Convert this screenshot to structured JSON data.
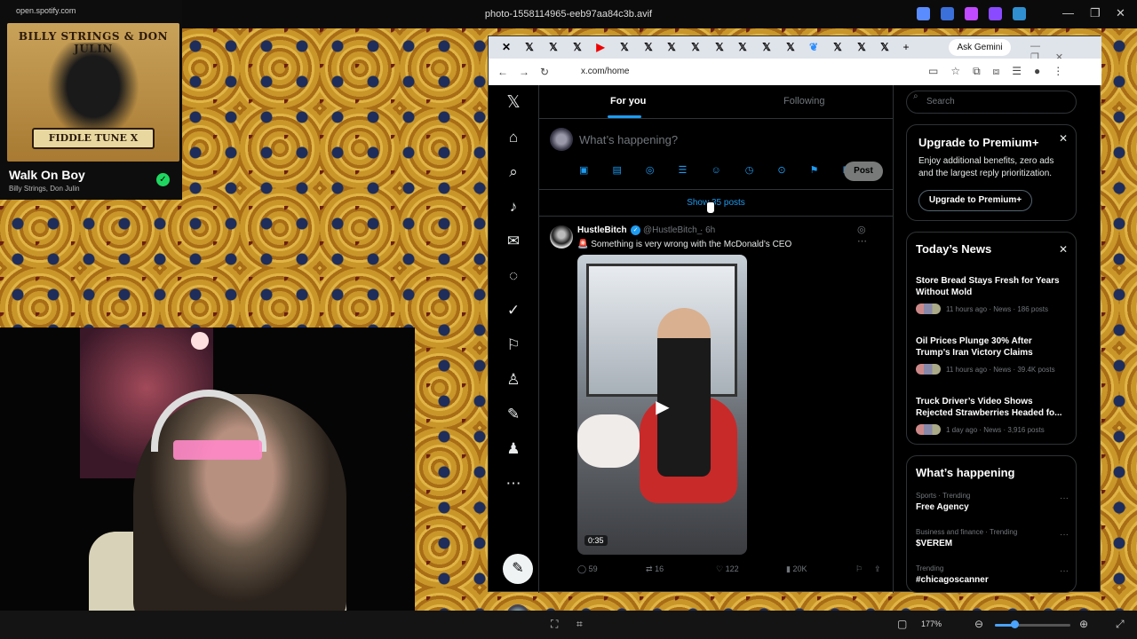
{
  "window": {
    "title": "photo-1558114965-eeb97aa84c3b.avif",
    "controls": [
      "—",
      "❐",
      "✕"
    ]
  },
  "spotify": {
    "url": "open.spotify.com",
    "album_band_text": "BILLY STRINGS & DON JULIN",
    "album_banner_text": "FIDDLE TUNE X",
    "song_title": "Walk On Boy",
    "artist": "Billy Strings, Don Julin"
  },
  "browser": {
    "ask_button": "Ask Gemini",
    "url": "x.com/home",
    "window_controls": "—❐✕"
  },
  "x": {
    "tabs": {
      "for_you": "For you",
      "following": "Following"
    },
    "compose_placeholder": "What’s happening?",
    "compose_tool_icons": "▣ ▤ ◎ ☰ ☺ ◷ ⊙ ⚑ B I",
    "post_button": "Post",
    "show_posts": "Show 35 posts",
    "nav_icons": {
      "logo": "𝕏",
      "home": "⌂",
      "explore": "⌕",
      "notifications": "♪",
      "messages": "✉",
      "grok": "◌",
      "verified": "✓",
      "bookmarks": "⚐",
      "premium": "♙",
      "articles": "✎",
      "profile": "♟",
      "more": "⋯",
      "post": "✎"
    },
    "tweet": {
      "author": "HustleBitch",
      "verified_mark": "✓",
      "handle": "@HustleBitch_",
      "time": "· 6h",
      "icons": "◎ ⋯",
      "text": "🚨 Something is very wrong with the McDonald’s CEO",
      "video_duration": "0:35",
      "play_icon": "▶",
      "replies": "59",
      "reposts": "16",
      "likes": "122",
      "views": "20K",
      "reply_icon": "◯",
      "repost_icon": "⇄",
      "like_icon": "♡",
      "views_icon": "▮",
      "bookmark_icon": "⚐",
      "share_icon": "⇪"
    },
    "search_placeholder": "Search",
    "search_icon": "⌕",
    "premium": {
      "title": "Upgrade to Premium+",
      "body": "Enjoy additional benefits, zero ads and the largest reply prioritization.",
      "button": "Upgrade to Premium+",
      "close": "✕"
    },
    "news": {
      "title": "Today’s News",
      "close": "✕",
      "items": [
        {
          "title": "Store Bread Stays Fresh for Years Without Mold",
          "meta": "11 hours ago · News · 186 posts"
        },
        {
          "title": "Oil Prices Plunge 30% After Trump’s Iran Victory Claims",
          "meta": "11 hours ago · News · 39.4K posts"
        },
        {
          "title": "Truck Driver’s Video Shows Rejected Strawberries Headed fo...",
          "meta": "1 day ago · News · 3,916 posts"
        }
      ]
    },
    "happening": {
      "title": "What’s happening",
      "more": "···",
      "trends": [
        {
          "context": "Sports · Trending",
          "name": "Free Agency"
        },
        {
          "context": "Business and finance · Trending",
          "name": "$VEREM"
        },
        {
          "context": "Trending",
          "name": "#chicagoscanner"
        }
      ]
    }
  },
  "viewer": {
    "zoom": "177%",
    "icons": {
      "fit": "⛶",
      "crop": "⌗",
      "frame": "▢",
      "zoom_out": "⊖",
      "zoom_in": "⊕",
      "expand": "⤢"
    },
    "zoom_fraction": 0.26
  },
  "colors": {
    "accent": "#1d9bf0",
    "spotify_green": "#1ed760"
  }
}
